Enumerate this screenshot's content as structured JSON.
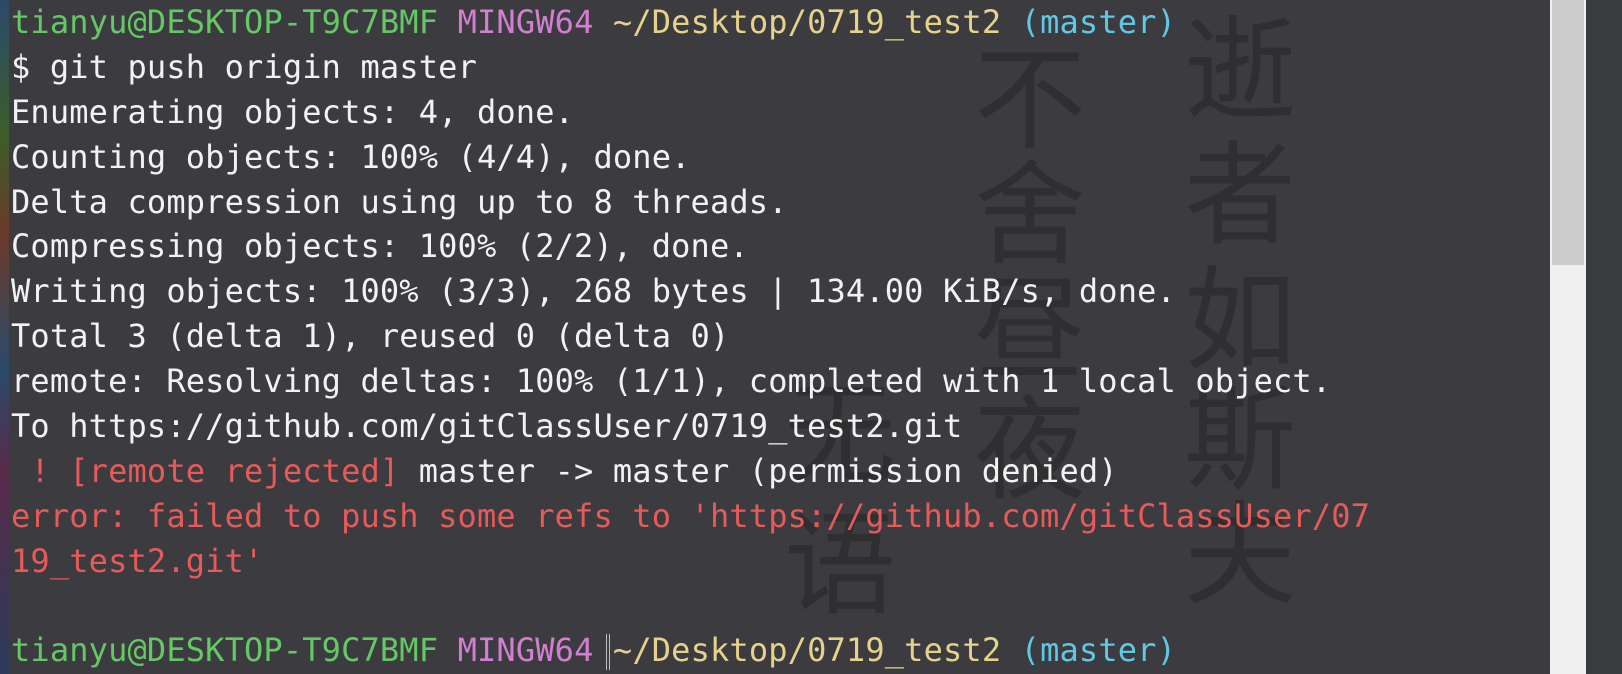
{
  "terminal": {
    "prompt_user_host": "tianyu@DESKTOP-T9C7BMF",
    "prompt_shell": "MINGW64",
    "prompt_path": "~/Desktop/0719_test2",
    "prompt_branch": "(master)",
    "command_prefix": "$ ",
    "command": "git push origin master",
    "output": [
      "Enumerating objects: 4, done.",
      "Counting objects: 100% (4/4), done.",
      "Delta compression using up to 8 threads.",
      "Compressing objects: 100% (2/2), done.",
      "Writing objects: 100% (3/3), 268 bytes | 134.00 KiB/s, done.",
      "Total 3 (delta 1), reused 0 (delta 0)",
      "remote: Resolving deltas: 100% (1/1), completed with 1 local object.",
      "To https://github.com/gitClassUser/0719_test2.git"
    ],
    "rejected_marker": " ! [remote rejected]",
    "rejected_detail": " master -> master (permission denied)",
    "error_line_1": "error: failed to push some refs to 'https://github.com/gitClassUser/07",
    "error_line_2": "19_test2.git'"
  },
  "wallpaper": {
    "calligraphy": [
      "逝",
      "者",
      "如",
      "斯",
      "夫",
      "不",
      "舍",
      "昼",
      "夜",
      "无",
      "语"
    ]
  },
  "colors": {
    "background": "#3c3c40",
    "user_host": "#64c864",
    "shell": "#d27fd2",
    "path": "#e6d28a",
    "branch": "#5fc8e6",
    "error": "#e65a5a"
  }
}
